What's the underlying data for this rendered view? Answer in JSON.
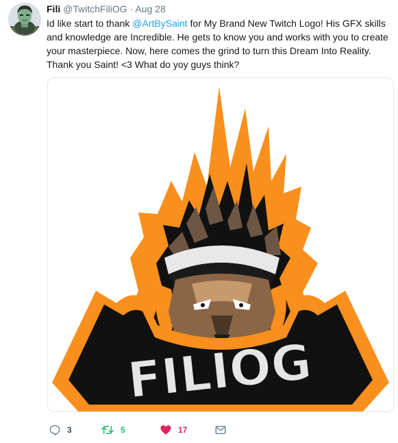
{
  "tweet": {
    "author_name": "Fili",
    "author_handle": "@TwitchFiliOG",
    "separator": "·",
    "timestamp": "Aug 28",
    "text_before_mention": "Id like start to thank ",
    "mention": "@ArtBySaint",
    "text_after_mention": " for My Brand New Twitch Logo! His GFX skills and knowledge are Incredible. He gets to know you and works with you to create your masterpiece. Now, here comes the grind to turn this Dream Into Reality. Thank you Saint! <3 What do yoy guys think?",
    "image": {
      "logo_text": "FILIOG"
    },
    "actions": {
      "reply": {
        "icon": "reply-icon",
        "count": "3"
      },
      "retweet": {
        "icon": "retweet-icon",
        "count": "5",
        "color": "#17bf63"
      },
      "like": {
        "icon": "heart-icon",
        "count": "17",
        "color": "#e0245e"
      },
      "direct_message": {
        "icon": "envelope-icon"
      }
    }
  },
  "colors": {
    "link": "#1da1f2",
    "secondary_text": "#657786",
    "primary_text": "#14171a",
    "logo_orange": "#f98f1d",
    "logo_black": "#111111"
  }
}
